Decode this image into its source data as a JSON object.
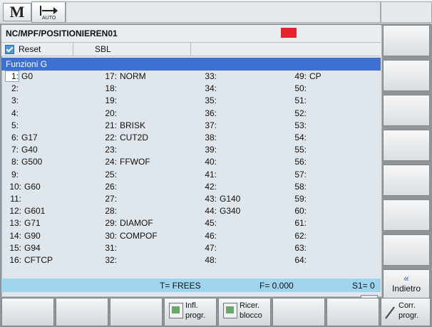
{
  "topbar": {
    "machine_icon": "M",
    "auto_label": "AUTO"
  },
  "program": {
    "path": "NC/MPF/POSITIONIEREN01",
    "status_flag_color": "#e4252b"
  },
  "channel": {
    "reset_label": "Reset",
    "mode_label": "SBL"
  },
  "panel": {
    "title": "Funzioni G"
  },
  "g_functions": [
    [
      "1:",
      "G0"
    ],
    [
      "2:",
      ""
    ],
    [
      "3:",
      ""
    ],
    [
      "4:",
      ""
    ],
    [
      "5:",
      ""
    ],
    [
      "6:",
      "G17"
    ],
    [
      "7:",
      "G40"
    ],
    [
      "8:",
      "G500"
    ],
    [
      "9:",
      ""
    ],
    [
      "10:",
      "G60"
    ],
    [
      "11:",
      ""
    ],
    [
      "12:",
      "G601"
    ],
    [
      "13:",
      "G71"
    ],
    [
      "14:",
      "G90"
    ],
    [
      "15:",
      "G94"
    ],
    [
      "16:",
      "CFTCP"
    ],
    [
      "17:",
      "NORM"
    ],
    [
      "18:",
      ""
    ],
    [
      "19:",
      ""
    ],
    [
      "20:",
      ""
    ],
    [
      "21:",
      "BRISK"
    ],
    [
      "22:",
      "CUT2D"
    ],
    [
      "23:",
      ""
    ],
    [
      "24:",
      "FFWOF"
    ],
    [
      "25:",
      ""
    ],
    [
      "26:",
      ""
    ],
    [
      "27:",
      ""
    ],
    [
      "28:",
      ""
    ],
    [
      "29:",
      "DIAMOF"
    ],
    [
      "30:",
      "COMPOF"
    ],
    [
      "31:",
      ""
    ],
    [
      "32:",
      ""
    ],
    [
      "33:",
      ""
    ],
    [
      "34:",
      ""
    ],
    [
      "35:",
      ""
    ],
    [
      "36:",
      ""
    ],
    [
      "37:",
      ""
    ],
    [
      "38:",
      ""
    ],
    [
      "39:",
      ""
    ],
    [
      "40:",
      ""
    ],
    [
      "41:",
      ""
    ],
    [
      "42:",
      ""
    ],
    [
      "43:",
      "G140"
    ],
    [
      "44:",
      "G340"
    ],
    [
      "45:",
      ""
    ],
    [
      "46:",
      ""
    ],
    [
      "47:",
      ""
    ],
    [
      "48:",
      ""
    ],
    [
      "49:",
      "CP"
    ],
    [
      "50:",
      ""
    ],
    [
      "51:",
      ""
    ],
    [
      "52:",
      ""
    ],
    [
      "53:",
      ""
    ],
    [
      "54:",
      ""
    ],
    [
      "55:",
      ""
    ],
    [
      "56:",
      ""
    ],
    [
      "57:",
      ""
    ],
    [
      "58:",
      ""
    ],
    [
      "59:",
      ""
    ],
    [
      "60:",
      ""
    ],
    [
      "61:",
      ""
    ],
    [
      "62:",
      ""
    ],
    [
      "63:",
      ""
    ],
    [
      "64:",
      ""
    ]
  ],
  "status": {
    "tool": "T= FREES",
    "feed": "F= 0.000",
    "spindle": "S1= 0",
    "more_arrow": ">"
  },
  "vertical_softkeys": {
    "back_arrow": "«",
    "back_label": "Indietro"
  },
  "horizontal_softkeys": {
    "prog_influence": [
      "Infl.",
      "progr."
    ],
    "block_search": [
      "Ricer.",
      "blocco"
    ],
    "prog_correct": [
      "Corr.",
      "progr."
    ]
  }
}
